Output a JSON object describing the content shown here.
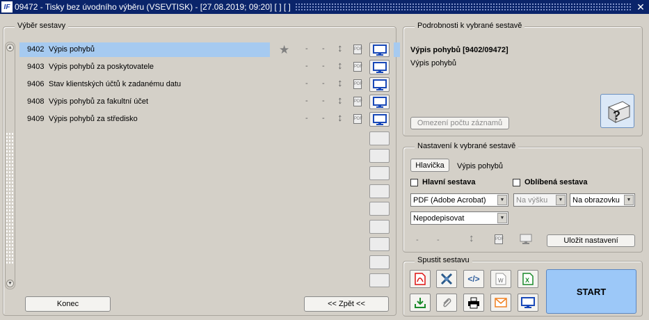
{
  "window": {
    "title": "09472 - Tisky bez úvodního výběru (VSEVTISK) - [27.08.2019; 09:20]  [ ]  [ ]",
    "app_icon": "IF"
  },
  "left_group": {
    "label": "Výběr sestavy"
  },
  "reports": [
    {
      "code": "9402",
      "name": "Výpis pohybů",
      "selected": true,
      "favorite": true
    },
    {
      "code": "9403",
      "name": "Výpis pohybů za poskytovatele",
      "selected": false,
      "favorite": false
    },
    {
      "code": "9406",
      "name": "Stav klientských účtů k zadanému datu",
      "selected": false,
      "favorite": false
    },
    {
      "code": "9408",
      "name": "Výpis pohybů za fakultní účet",
      "selected": false,
      "favorite": false
    },
    {
      "code": "9409",
      "name": "Výpis pohybů za středisko",
      "selected": false,
      "favorite": false
    }
  ],
  "row_dash": "-",
  "bottom": {
    "konec": "Konec",
    "zpet": "<< Zpět <<"
  },
  "details": {
    "label": "Podrobnosti k vybrané sestavě",
    "title": "Výpis pohybů [9402/09472]",
    "subtitle": "Výpis pohybů",
    "limit_button": "Omezení počtu záznamů"
  },
  "settings": {
    "label": "Nastavení k vybrané sestavě",
    "header_button": "Hlavička",
    "header_value": "Výpis pohybů",
    "main_report": "Hlavní sestava",
    "favorite_report": "Oblíbená sestava",
    "format": "PDF (Adobe Acrobat)",
    "orientation": "Na výšku",
    "output": "Na obrazovku",
    "signature": "Nepodepisovat",
    "dash": "-",
    "save_button": "Uložit nastavení"
  },
  "run": {
    "label": "Spustit sestavu",
    "start": "START"
  }
}
